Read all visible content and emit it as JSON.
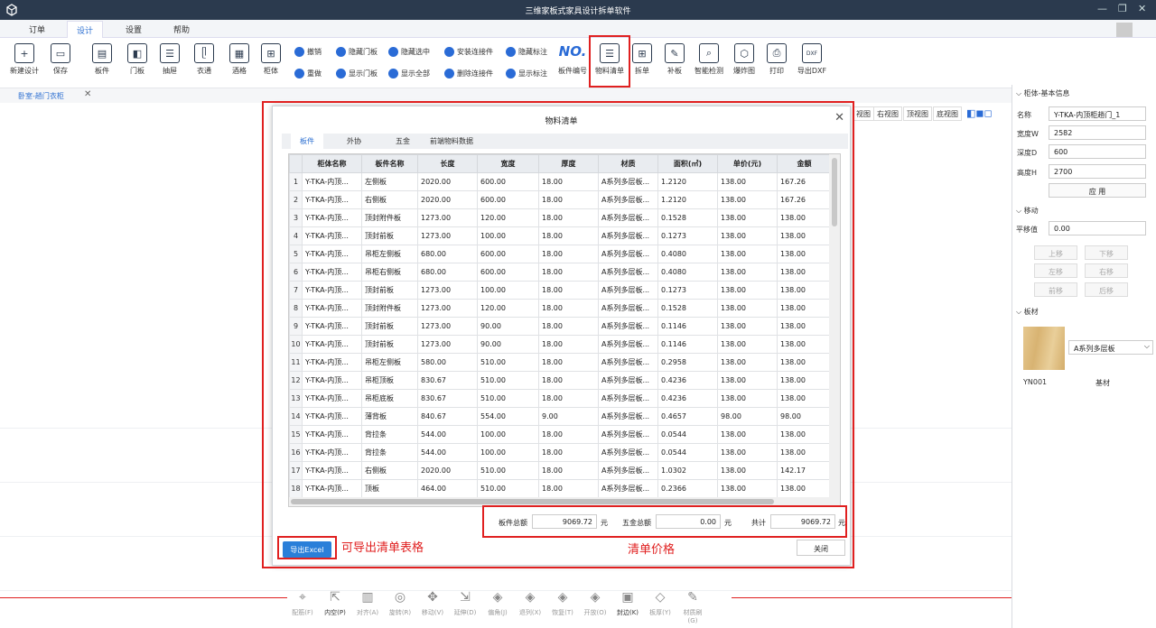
{
  "app": {
    "title": "三维家板式家具设计拆单软件"
  },
  "menu": [
    "订单",
    "设计",
    "设置",
    "帮助"
  ],
  "toolbar": {
    "big_left": [
      "新建设计",
      "保存",
      "板件",
      "门板",
      "抽屉",
      "衣通",
      "酒格",
      "柜体"
    ],
    "small": [
      [
        "撤销",
        "重做"
      ],
      [
        "隐藏门板",
        "显示门板"
      ],
      [
        "隐藏选中",
        "显示全部"
      ],
      [
        "安装连接件",
        "删除连接件"
      ],
      [
        "隐藏标注",
        "显示标注"
      ]
    ],
    "big_right": [
      "板件编号",
      "物料清单",
      "拆单",
      "补板",
      "智能检测",
      "爆炸图",
      "打印",
      "导出DXF"
    ],
    "no_glyph": "NO."
  },
  "doc_tab": {
    "label": "卧室-趟门衣柜",
    "close": "✕"
  },
  "views": [
    "视图",
    "右视图",
    "顶视图",
    "底视图"
  ],
  "dialog": {
    "title": "物料清单",
    "close": "✕",
    "tabs": [
      "板件",
      "外协",
      "五金",
      "前端物料数据"
    ],
    "columns": [
      "柜体名称",
      "板件名称",
      "长度",
      "宽度",
      "厚度",
      "材质",
      "面积(㎡)",
      "单价(元)",
      "金额"
    ],
    "rows": [
      [
        "1",
        "Y-TKA-内顶...",
        "左侧板",
        "2020.00",
        "600.00",
        "18.00",
        "A系列多层板...",
        "1.2120",
        "138.00",
        "167.26"
      ],
      [
        "2",
        "Y-TKA-内顶...",
        "右侧板",
        "2020.00",
        "600.00",
        "18.00",
        "A系列多层板...",
        "1.2120",
        "138.00",
        "167.26"
      ],
      [
        "3",
        "Y-TKA-内顶...",
        "顶封附件板",
        "1273.00",
        "120.00",
        "18.00",
        "A系列多层板...",
        "0.1528",
        "138.00",
        "138.00"
      ],
      [
        "4",
        "Y-TKA-内顶...",
        "顶封前板",
        "1273.00",
        "100.00",
        "18.00",
        "A系列多层板...",
        "0.1273",
        "138.00",
        "138.00"
      ],
      [
        "5",
        "Y-TKA-内顶...",
        "吊柜左侧板",
        "680.00",
        "600.00",
        "18.00",
        "A系列多层板...",
        "0.4080",
        "138.00",
        "138.00"
      ],
      [
        "6",
        "Y-TKA-内顶...",
        "吊柜右侧板",
        "680.00",
        "600.00",
        "18.00",
        "A系列多层板...",
        "0.4080",
        "138.00",
        "138.00"
      ],
      [
        "7",
        "Y-TKA-内顶...",
        "顶封前板",
        "1273.00",
        "100.00",
        "18.00",
        "A系列多层板...",
        "0.1273",
        "138.00",
        "138.00"
      ],
      [
        "8",
        "Y-TKA-内顶...",
        "顶封附件板",
        "1273.00",
        "120.00",
        "18.00",
        "A系列多层板...",
        "0.1528",
        "138.00",
        "138.00"
      ],
      [
        "9",
        "Y-TKA-内顶...",
        "顶封前板",
        "1273.00",
        "90.00",
        "18.00",
        "A系列多层板...",
        "0.1146",
        "138.00",
        "138.00"
      ],
      [
        "10",
        "Y-TKA-内顶...",
        "顶封前板",
        "1273.00",
        "90.00",
        "18.00",
        "A系列多层板...",
        "0.1146",
        "138.00",
        "138.00"
      ],
      [
        "11",
        "Y-TKA-内顶...",
        "吊柜左侧板",
        "580.00",
        "510.00",
        "18.00",
        "A系列多层板...",
        "0.2958",
        "138.00",
        "138.00"
      ],
      [
        "12",
        "Y-TKA-内顶...",
        "吊柜顶板",
        "830.67",
        "510.00",
        "18.00",
        "A系列多层板...",
        "0.4236",
        "138.00",
        "138.00"
      ],
      [
        "13",
        "Y-TKA-内顶...",
        "吊柜底板",
        "830.67",
        "510.00",
        "18.00",
        "A系列多层板...",
        "0.4236",
        "138.00",
        "138.00"
      ],
      [
        "14",
        "Y-TKA-内顶...",
        "薄背板",
        "840.67",
        "554.00",
        "9.00",
        "A系列多层板...",
        "0.4657",
        "98.00",
        "98.00"
      ],
      [
        "15",
        "Y-TKA-内顶...",
        "背拉条",
        "544.00",
        "100.00",
        "18.00",
        "A系列多层板...",
        "0.0544",
        "138.00",
        "138.00"
      ],
      [
        "16",
        "Y-TKA-内顶...",
        "背拉条",
        "544.00",
        "100.00",
        "18.00",
        "A系列多层板...",
        "0.0544",
        "138.00",
        "138.00"
      ],
      [
        "17",
        "Y-TKA-内顶...",
        "右侧板",
        "2020.00",
        "510.00",
        "18.00",
        "A系列多层板...",
        "1.0302",
        "138.00",
        "142.17"
      ],
      [
        "18",
        "Y-TKA-内顶...",
        "顶板",
        "464.00",
        "510.00",
        "18.00",
        "A系列多层板...",
        "0.2366",
        "138.00",
        "138.00"
      ]
    ],
    "totals": {
      "board_label": "板件总额",
      "board_value": "9069.72",
      "unit": "元",
      "hardware_label": "五金总额",
      "hardware_value": "0.00",
      "sum_label": "共计",
      "sum_value": "9069.72"
    },
    "export_label": "导出Excel",
    "close_label": "关闭"
  },
  "annotations": {
    "export": "可导出清单表格",
    "price": "清单价格"
  },
  "right_panel": {
    "section_basic": "柜体-基本信息",
    "name_label": "名称",
    "name_value": "Y-TKA-内顶柜趟门_1",
    "width_label": "宽度W",
    "width_value": "2582",
    "depth_label": "深度D",
    "depth_value": "600",
    "height_label": "高度H",
    "height_value": "2700",
    "apply": "应 用",
    "section_move": "移动",
    "offset_label": "平移值",
    "offset_value": "0.00",
    "move_buttons": [
      "上移",
      "下移",
      "左移",
      "右移",
      "前移",
      "后移"
    ],
    "section_material": "板材",
    "material_select": "A系列多层板",
    "material_code": "YN001",
    "material_type": "基材"
  },
  "bottom_tools": [
    "配筋(F)",
    "内空(P)",
    "对齐(A)",
    "旋转(R)",
    "移动(V)",
    "延伸(D)",
    "偏角(J)",
    "退列(X)",
    "恢复(T)",
    "开放(O)",
    "封边(K)",
    "板厚(Y)",
    "材质刷(G)"
  ]
}
